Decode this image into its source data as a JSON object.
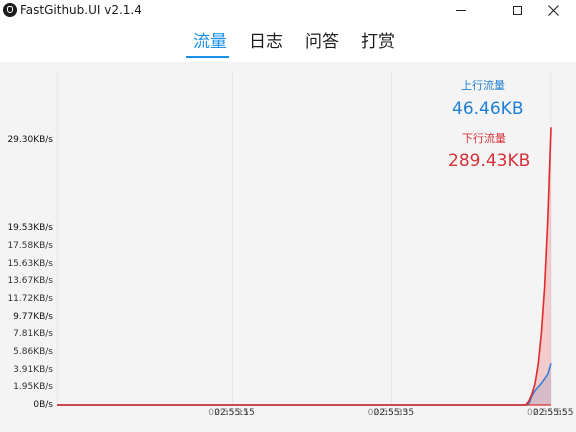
{
  "window": {
    "title": "FastGithub.UI v2.1.4"
  },
  "tabs": [
    {
      "label": "流量",
      "active": true
    },
    {
      "label": "日志",
      "active": false
    },
    {
      "label": "问答",
      "active": false
    },
    {
      "label": "打赏",
      "active": false
    }
  ],
  "stats": {
    "upload": {
      "label": "上行流量",
      "value": "46.46KB",
      "color": "#1e7fd6"
    },
    "download": {
      "label": "下行流量",
      "value": "289.43KB",
      "color": "#d6303a"
    }
  },
  "chart_data": {
    "type": "area",
    "y_unit": "KB/s",
    "y_ticks": [
      "0B/s",
      "1.95KB/s",
      "3.91KB/s",
      "5.86KB/s",
      "7.81KB/s",
      "9.77KB/s",
      "11.72KB/s",
      "13.67KB/s",
      "15.63KB/s",
      "17.58KB/s",
      "19.53KB/s",
      "29.30KB/s"
    ],
    "y_tick_values": [
      0,
      1.95,
      3.91,
      5.86,
      7.81,
      9.77,
      11.72,
      13.67,
      15.63,
      17.58,
      19.53,
      29.3
    ],
    "ylim": [
      0,
      29.3
    ],
    "x_ticks": [
      {
        "label": "02:55:15",
        "t": 15
      },
      {
        "label": "02:55:35",
        "t": 35
      },
      {
        "label": "02:55:55",
        "t": 55
      }
    ],
    "xlim": [
      -7,
      55
    ],
    "series": [
      {
        "name": "上行流量",
        "color": "#3b7fd8",
        "fill": "rgba(59,127,216,0.18)",
        "points": [
          [
            -7,
            0
          ],
          [
            52,
            0
          ],
          [
            52.3,
            0.3
          ],
          [
            52.6,
            1.0
          ],
          [
            53,
            1.6
          ],
          [
            53.4,
            2.0
          ],
          [
            53.8,
            2.4
          ],
          [
            54.2,
            2.9
          ],
          [
            54.6,
            3.4
          ],
          [
            55,
            4.6
          ]
        ]
      },
      {
        "name": "下行流量",
        "color": "#e02a2a",
        "fill": "rgba(230,60,60,0.22)",
        "points": [
          [
            -7,
            0
          ],
          [
            51.8,
            0
          ],
          [
            52.2,
            0.4
          ],
          [
            52.6,
            1.2
          ],
          [
            53,
            2.4
          ],
          [
            53.4,
            4.6
          ],
          [
            53.8,
            8.0
          ],
          [
            54.2,
            13.0
          ],
          [
            54.6,
            20.5
          ],
          [
            55,
            30.7
          ]
        ]
      }
    ]
  }
}
